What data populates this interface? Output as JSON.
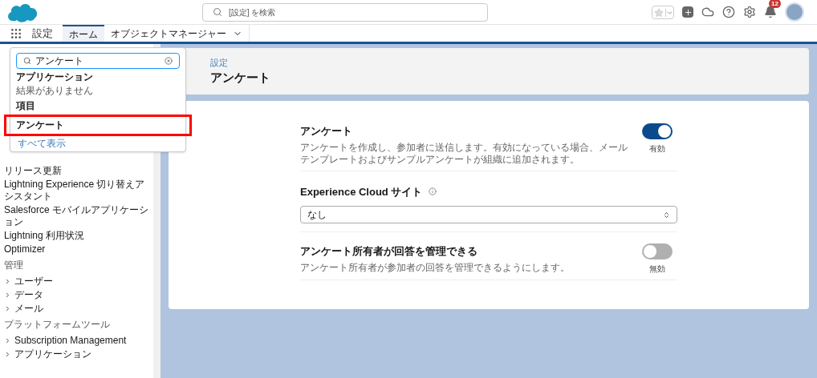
{
  "header": {
    "search_placeholder": "[設定] を検索",
    "notification_count": "12"
  },
  "nav": {
    "app_name": "設定",
    "tabs": [
      {
        "label": "ホーム",
        "selected": true,
        "has_menu": false
      },
      {
        "label": "オブジェクトマネージャー",
        "selected": false,
        "has_menu": true
      }
    ]
  },
  "quick_find": {
    "value": "アンケート",
    "sections": [
      {
        "heading": "アプリケーション",
        "items": [
          {
            "label": "結果がありません",
            "kind": "empty",
            "highlighted": false
          }
        ]
      },
      {
        "heading": "項目",
        "items": [
          {
            "label": "アンケート",
            "kind": "result",
            "highlighted": true
          }
        ]
      }
    ],
    "show_all": "すべて表示"
  },
  "sidebar": {
    "items": [
      {
        "label": "リリース更新",
        "kind": "link"
      },
      {
        "label": "Lightning Experience 切り替えアシスタント",
        "kind": "link"
      },
      {
        "label": "Salesforce モバイルアプリケーション",
        "kind": "link"
      },
      {
        "label": "Lightning 利用状況",
        "kind": "link"
      },
      {
        "label": "Optimizer",
        "kind": "link"
      },
      {
        "label": "管理",
        "kind": "heading"
      },
      {
        "label": "ユーザー",
        "kind": "expandable"
      },
      {
        "label": "データ",
        "kind": "expandable"
      },
      {
        "label": "メール",
        "kind": "expandable"
      },
      {
        "label": "プラットフォームツール",
        "kind": "heading"
      },
      {
        "label": "Subscription Management",
        "kind": "expandable"
      },
      {
        "label": "アプリケーション",
        "kind": "expandable"
      }
    ]
  },
  "page_header": {
    "breadcrumb": "設定",
    "title": "アンケート"
  },
  "settings": [
    {
      "kind": "toggle",
      "title": "アンケート",
      "description": "アンケートを作成し、参加者に送信します。有効になっている場合、メールテンプレートおよびサンプルアンケートが組織に追加されます。",
      "on": true,
      "state_label": "有効"
    },
    {
      "kind": "select",
      "title": "Experience Cloud サイト",
      "value": "なし"
    },
    {
      "kind": "toggle",
      "title": "アンケート所有者が回答を管理できる",
      "description": "アンケート所有者が参加者の回答を管理できるようにします。",
      "on": false,
      "state_label": "無効"
    }
  ]
}
